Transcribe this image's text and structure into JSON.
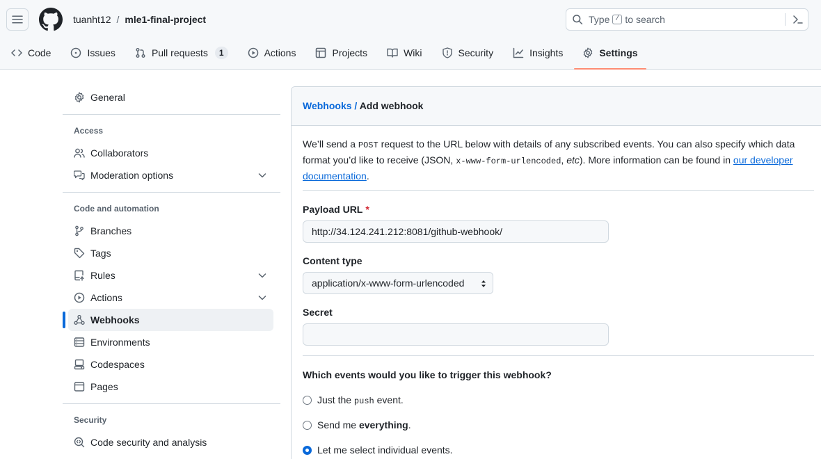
{
  "header": {
    "owner": "tuanht12",
    "separator": "/",
    "repo": "mle1-final-project",
    "search": {
      "prefix": "Type",
      "key": "/",
      "suffix": "to search"
    }
  },
  "tabs": [
    {
      "label": "Code",
      "icon": "code-icon"
    },
    {
      "label": "Issues",
      "icon": "issue-icon"
    },
    {
      "label": "Pull requests",
      "icon": "pull-request-icon",
      "count": "1"
    },
    {
      "label": "Actions",
      "icon": "play-icon"
    },
    {
      "label": "Projects",
      "icon": "table-icon"
    },
    {
      "label": "Wiki",
      "icon": "book-icon"
    },
    {
      "label": "Security",
      "icon": "shield-icon"
    },
    {
      "label": "Insights",
      "icon": "graph-icon"
    },
    {
      "label": "Settings",
      "icon": "gear-icon",
      "active": true
    }
  ],
  "sidebar": {
    "general": "General",
    "groups": {
      "access": "Access",
      "code_automation": "Code and automation",
      "security": "Security"
    },
    "items": {
      "collaborators": "Collaborators",
      "moderation": "Moderation options",
      "branches": "Branches",
      "tags": "Tags",
      "rules": "Rules",
      "actions": "Actions",
      "webhooks": "Webhooks",
      "environments": "Environments",
      "codespaces": "Codespaces",
      "pages": "Pages",
      "code_security": "Code security and analysis"
    }
  },
  "main": {
    "breadcrumb_link": "Webhooks",
    "breadcrumb_sep": "/",
    "title": "Add webhook",
    "desc": {
      "t1": "We’ll send a ",
      "code1": "POST",
      "t2": " request to the URL below with details of any subscribed events. You can also specify which data format you’d like to receive (JSON, ",
      "code2": "x-www-form-urlencoded",
      "t3": ", ",
      "em": "etc",
      "t4": "). More information can be found in ",
      "link": "our developer documentation",
      "t5": "."
    },
    "payload_label": "Payload URL",
    "required_mark": "*",
    "payload_value": "http://34.124.241.212:8081/github-webhook/",
    "content_type_label": "Content type",
    "content_type_value": "application/x-www-form-urlencoded",
    "secret_label": "Secret",
    "secret_value": "",
    "events_question": "Which events would you like to trigger this webhook?",
    "events": {
      "just_push_pre": "Just the ",
      "just_push_code": "push",
      "just_push_post": " event.",
      "everything_pre": "Send me ",
      "everything_bold": "everything",
      "everything_post": ".",
      "individual": "Let me select individual events."
    },
    "selected_event": "individual"
  }
}
